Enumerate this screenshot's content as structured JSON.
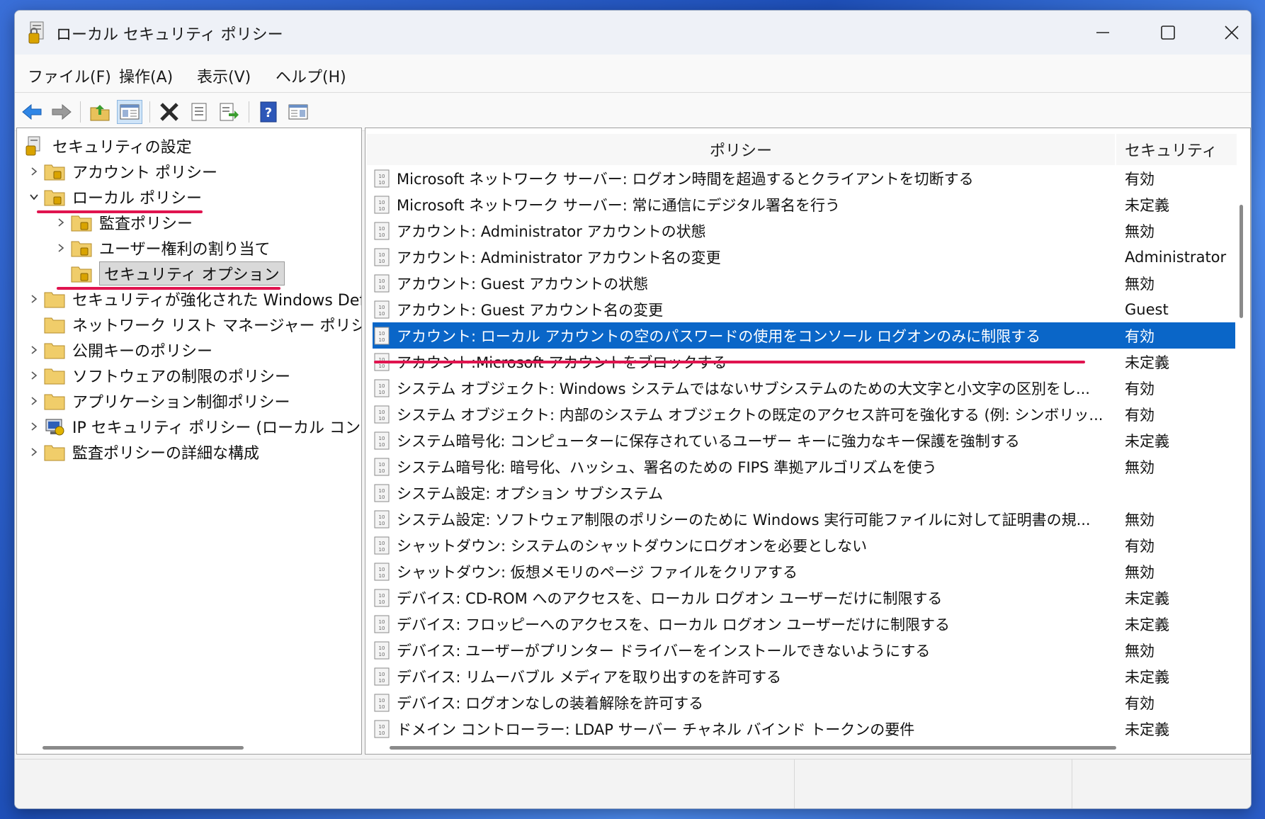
{
  "window": {
    "title": "ローカル セキュリティ ポリシー"
  },
  "menu": [
    "ファイル(F)",
    "操作(A)",
    "表示(V)",
    "ヘルプ(H)"
  ],
  "toolbar": [
    "back-arrow-icon",
    "forward-arrow-icon",
    "up-folder-icon",
    "show-hide-tree-icon",
    "delete-icon",
    "properties-icon",
    "export-list-icon",
    "help-icon",
    "show-hide-action-pane-icon"
  ],
  "tree": {
    "root": "セキュリティの設定",
    "items": [
      {
        "label": "アカウント ポリシー",
        "expanded": false
      },
      {
        "label": "ローカル ポリシー",
        "expanded": true
      },
      {
        "label": "監査ポリシー",
        "expanded": false
      },
      {
        "label": "ユーザー権利の割り当て",
        "expanded": false
      },
      {
        "label": "セキュリティ オプション",
        "selected": true
      },
      {
        "label": "セキュリティが強化された Windows Defe",
        "expanded": false
      },
      {
        "label": "ネットワーク リスト マネージャー ポリシー"
      },
      {
        "label": "公開キーのポリシー",
        "expanded": false
      },
      {
        "label": "ソフトウェアの制限のポリシー",
        "expanded": false
      },
      {
        "label": "アプリケーション制御ポリシー",
        "expanded": false
      },
      {
        "label": "IP セキュリティ ポリシー (ローカル コンピ",
        "expanded": false
      },
      {
        "label": "監査ポリシーの詳細な構成",
        "expanded": false
      }
    ]
  },
  "list": {
    "headers": {
      "policy": "ポリシー",
      "setting": "セキュリティ"
    },
    "rows": [
      {
        "policy": "Microsoft ネットワーク サーバー: ログオン時間を超過するとクライアントを切断する",
        "setting": "有効"
      },
      {
        "policy": "Microsoft ネットワーク サーバー: 常に通信にデジタル署名を行う",
        "setting": "未定義"
      },
      {
        "policy": "アカウント: Administrator アカウントの状態",
        "setting": "無効"
      },
      {
        "policy": "アカウント: Administrator アカウント名の変更",
        "setting": "Administrator"
      },
      {
        "policy": "アカウント: Guest アカウントの状態",
        "setting": "無効"
      },
      {
        "policy": "アカウント: Guest アカウント名の変更",
        "setting": "Guest"
      },
      {
        "policy": "アカウント: ローカル アカウントの空のパスワードの使用をコンソール ログオンのみに制限する",
        "setting": "有効",
        "selected": true
      },
      {
        "policy": "アカウント:Microsoft アカウントをブロックする",
        "setting": "未定義"
      },
      {
        "policy": "システム オブジェクト: Windows システムではないサブシステムのための大文字と小文字の区別をし...",
        "setting": "有効"
      },
      {
        "policy": "システム オブジェクト: 内部のシステム オブジェクトの既定のアクセス許可を強化する (例: シンボリッ...",
        "setting": "有効"
      },
      {
        "policy": "システム暗号化: コンピューターに保存されているユーザー キーに強力なキー保護を強制する",
        "setting": "未定義"
      },
      {
        "policy": "システム暗号化: 暗号化、ハッシュ、署名のための FIPS 準拠アルゴリズムを使う",
        "setting": "無効"
      },
      {
        "policy": "システム設定: オプション サブシステム",
        "setting": ""
      },
      {
        "policy": "システム設定: ソフトウェア制限のポリシーのために Windows 実行可能ファイルに対して証明書の規...",
        "setting": "無効"
      },
      {
        "policy": "シャットダウン: システムのシャットダウンにログオンを必要としない",
        "setting": "有効"
      },
      {
        "policy": "シャットダウン: 仮想メモリのページ ファイルをクリアする",
        "setting": "無効"
      },
      {
        "policy": "デバイス: CD-ROM へのアクセスを、ローカル ログオン ユーザーだけに制限する",
        "setting": "未定義"
      },
      {
        "policy": "デバイス: フロッピーへのアクセスを、ローカル ログオン ユーザーだけに制限する",
        "setting": "未定義"
      },
      {
        "policy": "デバイス: ユーザーがプリンター ドライバーをインストールできないようにする",
        "setting": "無効"
      },
      {
        "policy": "デバイス: リムーバブル メディアを取り出すのを許可する",
        "setting": "未定義"
      },
      {
        "policy": "デバイス: ログオンなしの装着解除を許可する",
        "setting": "有効"
      },
      {
        "policy": "ドメイン コントローラー: LDAP サーバー チャネル バインド トークンの要件",
        "setting": "未定義"
      }
    ]
  },
  "colors": {
    "selection": "#0a66c8",
    "annotation": "#e0144f"
  }
}
